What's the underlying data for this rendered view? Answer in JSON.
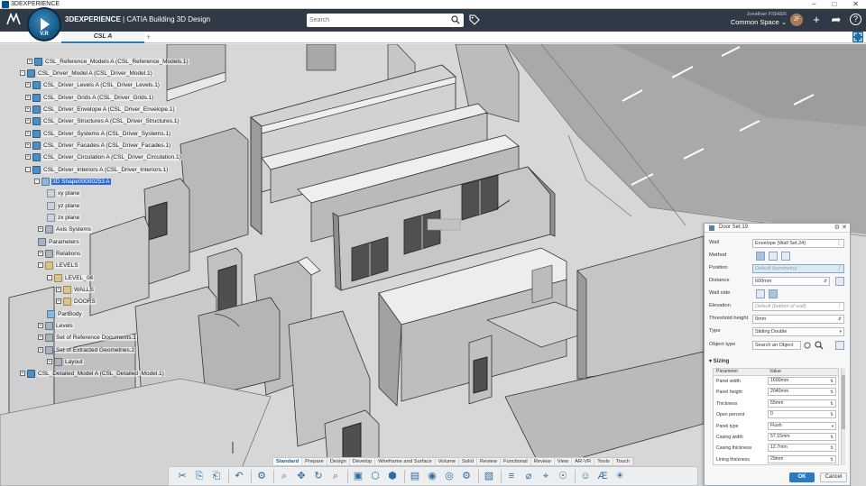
{
  "window": {
    "title": "3DEXPERIENCE",
    "min_glyph": "–",
    "max_glyph": "□",
    "close_glyph": "✕"
  },
  "topbar": {
    "app_title_bold": "3DEXPERIENCE",
    "app_title_rest": " | CATIA Building 3D Design",
    "compass_version": "V.R",
    "search_placeholder": "Search",
    "user_name": "Jonathan FISHER",
    "space": "Common Space ⌄",
    "avatar_initials": "JF",
    "icons": [
      "tag-icon",
      "add-icon",
      "share-icon",
      "help-icon"
    ],
    "add_glyph": "+",
    "share_glyph": "➦",
    "help_glyph": "?"
  },
  "tabs": {
    "active": "CSL A",
    "add": "+"
  },
  "tree": [
    {
      "label": "CSL_Reference_Models A (CSL_Reference_Models.1)",
      "icon": "prod",
      "exp": "+"
    },
    {
      "label": "CSL_Driver_Model A (CSL_Driver_Model.1)",
      "icon": "prod",
      "exp": "-"
    },
    {
      "label": "CSL_Driver_Levels A (CSL_Driver_Levels.1)",
      "icon": "prod",
      "exp": "+"
    },
    {
      "label": "CSL_Driver_Grids A (CSL_Driver_Grids.1)",
      "icon": "prod",
      "exp": "+"
    },
    {
      "label": "CSL_Driver_Envelope A (CSL_Driver_Envelope.1)",
      "icon": "prod",
      "exp": "+"
    },
    {
      "label": "CSL_Driver_Structures A (CSL_Driver_Structures.1)",
      "icon": "prod",
      "exp": "+"
    },
    {
      "label": "CSL_Driver_Systems A (CSL_Driver_Systems.1)",
      "icon": "prod",
      "exp": "+"
    },
    {
      "label": "CSL_Driver_Facades A (CSL_Driver_Facades.1)",
      "icon": "prod",
      "exp": "+"
    },
    {
      "label": "CSL_Driver_Circulation A (CSL_Driver_Circulation.1)",
      "icon": "prod",
      "exp": "+"
    },
    {
      "label": "CSL_Driver_Interiors A (CSL_Driver_Interiors.1)",
      "icon": "prod",
      "exp": "-"
    },
    {
      "label": "3D Shape00000253 A",
      "icon": "part",
      "exp": "-",
      "selected": true
    },
    {
      "label": "xy plane",
      "icon": "plane",
      "exp": ""
    },
    {
      "label": "yz plane",
      "icon": "plane",
      "exp": ""
    },
    {
      "label": "zx plane",
      "icon": "plane",
      "exp": ""
    },
    {
      "label": "Axis Systems",
      "icon": "geo",
      "exp": "+"
    },
    {
      "label": "Parameters",
      "icon": "geo",
      "exp": ""
    },
    {
      "label": "Relations",
      "icon": "geo",
      "exp": "+"
    },
    {
      "label": "LEVELS",
      "icon": "folder",
      "exp": "-"
    },
    {
      "label": "LEVEL_04",
      "icon": "folder",
      "exp": "-"
    },
    {
      "label": "WALLS",
      "icon": "folder",
      "exp": "+"
    },
    {
      "label": "DOORS",
      "icon": "folder",
      "exp": "+"
    },
    {
      "label": "PartBody",
      "icon": "part",
      "exp": ""
    },
    {
      "label": "Levels",
      "icon": "geo",
      "exp": "+"
    },
    {
      "label": "Set of Reference Documents.1",
      "icon": "geo",
      "exp": "+"
    },
    {
      "label": "Set of Extracted Geometries.2",
      "icon": "geo",
      "exp": "+"
    },
    {
      "label": "Layout",
      "icon": "geo",
      "exp": "+"
    },
    {
      "label": "CSL_Detailed_Model A (CSL_Detailed_Model.1)",
      "icon": "prod",
      "exp": "+"
    }
  ],
  "door_panel": {
    "title": "Door Set.19",
    "settings_glyph": "⚙",
    "close_glyph": "✕",
    "dropdown_glyph": "▾",
    "rows": {
      "wall": {
        "label": "Wall",
        "value": "Envelope (Wall Set.24)"
      },
      "method": {
        "label": "Method"
      },
      "position": {
        "label": "Position",
        "value": "Default (symmetry)"
      },
      "distance": {
        "label": "Distance",
        "value": "600mm"
      },
      "wall_side": {
        "label": "Wall side"
      },
      "elevation": {
        "label": "Elevation",
        "value": "Default (bottom of wall)"
      },
      "threshold": {
        "label": "Threshold height",
        "value": "0mm"
      },
      "type": {
        "label": "Type",
        "value": "Sliding Double"
      },
      "object_type": {
        "label": "Object type",
        "value": "Search an Object"
      }
    },
    "sizing_title": "▾ Sizing",
    "table_headers": [
      "Parameter",
      "Value"
    ],
    "parameters": [
      {
        "name": "Panel width",
        "value": "1600mm"
      },
      {
        "name": "Panel height",
        "value": "2040mm"
      },
      {
        "name": "Thickness",
        "value": "55mm"
      },
      {
        "name": "Open percent",
        "value": "0"
      },
      {
        "name": "Panel type",
        "value": "Flush",
        "dropdown": true
      },
      {
        "name": "Casing width",
        "value": "57.15mm"
      },
      {
        "name": "Casing thickness",
        "value": "12.7mm"
      },
      {
        "name": "Lining thickness",
        "value": "29mm"
      }
    ],
    "ok": "OK",
    "cancel": "Cancel"
  },
  "section_tabs": [
    "Standard",
    "Prepare",
    "Design",
    "Develop",
    "Wireframe and Surface",
    "Volume",
    "Solid",
    "Review",
    "Functional",
    "Review",
    "View",
    "AR-VR",
    "Tools",
    "Touch"
  ],
  "section_tab_active": 0,
  "action_bar": {
    "groups": [
      [
        "cut-icon",
        "copy-icon",
        "paste-icon"
      ],
      [
        "undo-icon"
      ],
      [
        "snap-icon"
      ],
      [
        "zoom-icon",
        "pan-icon",
        "rotate-icon",
        "search-icon"
      ],
      [
        "capture-icon",
        "view-icon",
        "cube-icon"
      ],
      [
        "note-icon",
        "render-icon",
        "material-icon",
        "gear-icon"
      ],
      [
        "select-icon"
      ],
      [
        "align-icon",
        "measure-icon",
        "compass-icon",
        "sensor-icon"
      ],
      [
        "person-icon",
        "text-icon",
        "shine-icon"
      ]
    ]
  }
}
